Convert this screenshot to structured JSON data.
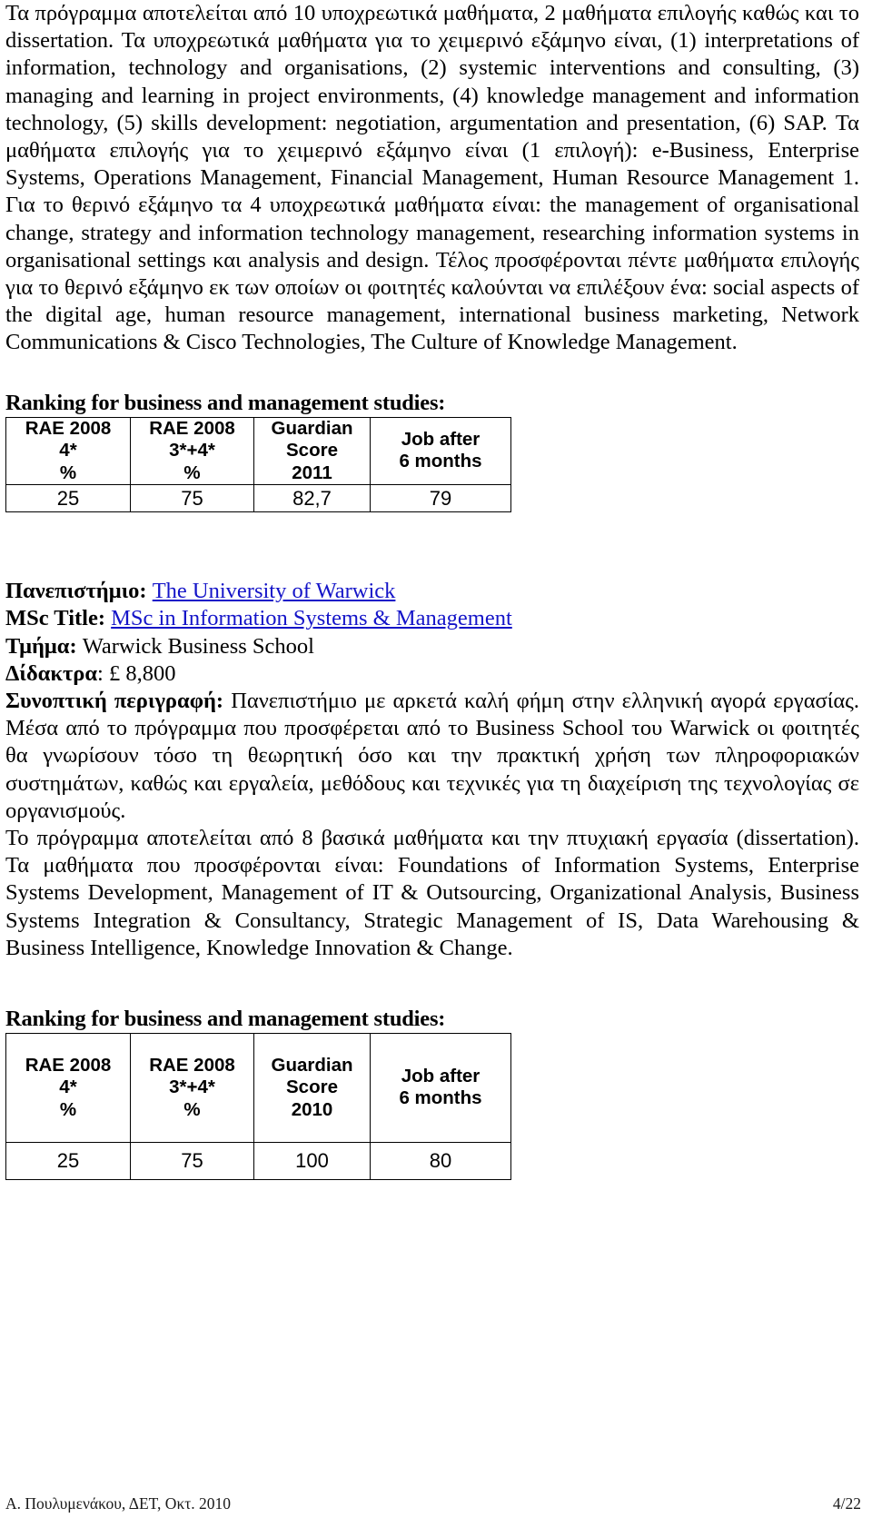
{
  "document": {
    "intro_paragraph": "Τα πρόγραμμα αποτελείται από 10 υποχρεωτικά μαθήματα, 2 μαθήματα επιλογής καθώς και το dissertation. Τα υποχρεωτικά μαθήματα για το χειμερινό εξάμηνο είναι, (1) interpretations of information, technology and organisations, (2) systemic interventions and consulting, (3) managing and learning in project environments, (4) knowledge management and information technology, (5) skills development: negotiation, argumentation and presentation, (6) SAP. Τα μαθήματα επιλογής για το χειμερινό εξάμηνο είναι (1 επιλογή): e-Business, Enterprise Systems, Operations Management, Financial Management, Human Resource Management 1. Για το θερινό εξάμηνο τα 4 υποχρεωτικά μαθήματα είναι: the management of organisational change, strategy and information technology management, researching information systems in organisational settings και analysis and design. Τέλος προσφέρονται πέντε μαθήματα επιλογής για το θερινό εξάμηνο εκ των οποίων οι φοιτητές καλούνται να επιλέξουν ένα: social aspects of the digital age, human resource management, international business marketing, Network Communications & Cisco Technologies, The Culture of Knowledge Management."
  },
  "ranking_section_1": {
    "heading": "Ranking for business and management studies:",
    "table": {
      "headers": [
        [
          "RAE 2008",
          "4*",
          "%"
        ],
        [
          "RAE 2008",
          "3*+4*",
          "%"
        ],
        [
          "Guardian",
          "Score",
          "2011"
        ],
        [
          "Job after",
          "6 months"
        ]
      ],
      "values": [
        "25",
        "75",
        "82,7",
        "79"
      ]
    }
  },
  "university_block": {
    "university_label": "Πανεπιστήμιο:",
    "university_value": "The University of Warwick",
    "msc_label": "MSc Title:",
    "msc_value": "MSc in Information Systems & Management",
    "department_label": "Τμήμα:",
    "department_value": "Warwick Business School",
    "tuition_label": "Δίδακτρα",
    "tuition_value": ": £ 8,800",
    "summary_label": "Συνοπτική περιγραφή:",
    "summary_text": " Πανεπιστήμιο με αρκετά καλή φήμη στην ελληνική αγορά εργασίας. Μέσα από το πρόγραμμα που προσφέρεται από το Business School του Warwick οι φοιτητές θα γνωρίσουν τόσο τη θεωρητική όσο και την πρακτική χρήση των πληροφοριακών συστημάτων, καθώς και εργαλεία, μεθόδους και τεχνικές για τη διαχείριση της τεχνολογίας σε οργανισμούς.",
    "programme_text": "Το πρόγραμμα αποτελείται από 8 βασικά μαθήματα και την πτυχιακή εργασία (dissertation). Τα μαθήματα που προσφέρονται είναι: Foundations of Information Systems, Enterprise Systems Development, Management of IT & Outsourcing, Organizational Analysis, Business Systems Integration & Consultancy, Strategic Management of IS, Data Warehousing & Business Intelligence, Knowledge Innovation & Change."
  },
  "ranking_section_2": {
    "heading": "Ranking for business and management studies:",
    "table": {
      "headers": [
        [
          "RAE 2008",
          "4*",
          "%"
        ],
        [
          "RAE 2008",
          "3*+4*",
          "%"
        ],
        [
          "Guardian",
          "Score",
          "2010"
        ],
        [
          "Job after",
          "6 months"
        ]
      ],
      "values": [
        "25",
        "75",
        "100",
        "80"
      ]
    }
  },
  "footer": {
    "left": "Α. Πουλυμενάκου, ΔΕΤ, Οκτ. 2010",
    "right": "4/22"
  }
}
